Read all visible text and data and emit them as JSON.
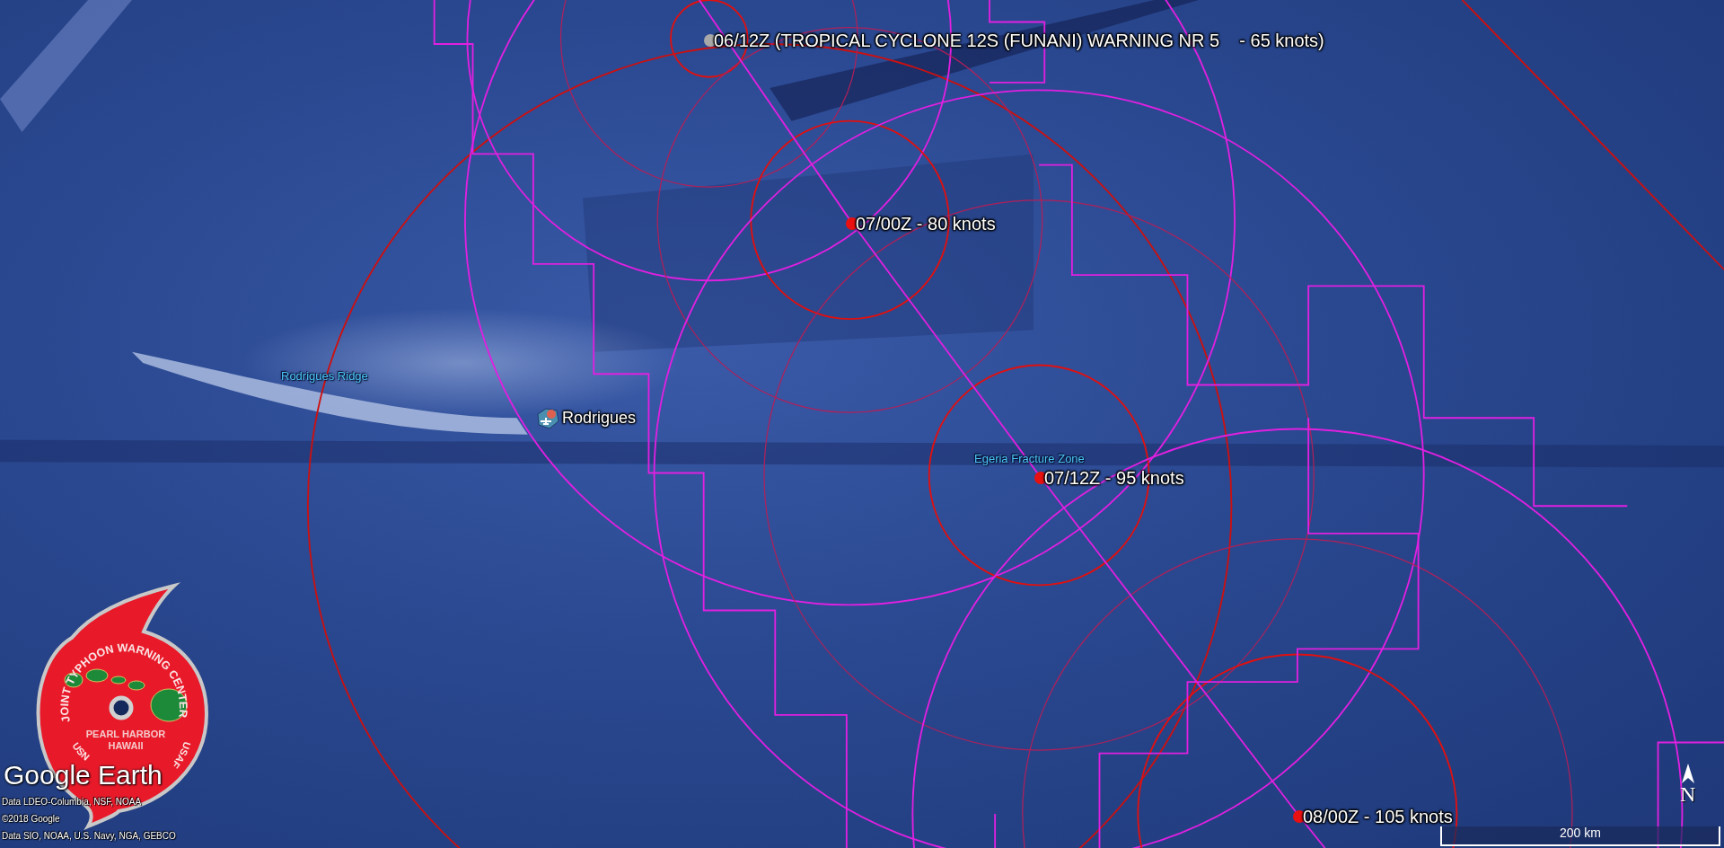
{
  "forecast_points": [
    {
      "label": "06/12Z (TROPICAL CYCLONE 12S (FUNANI) WARNING NR 5    - 65 knots)",
      "current": true
    },
    {
      "label": "07/00Z - 80 knots",
      "current": false
    },
    {
      "label": "07/12Z - 95 knots",
      "current": false
    },
    {
      "label": "08/00Z - 105 knots",
      "current": false
    }
  ],
  "places": [
    {
      "label": "Rodrigues Ridge",
      "kind": "feature"
    },
    {
      "label": "Rodrigues",
      "kind": "island"
    },
    {
      "label": "Egeria Fracture Zone",
      "kind": "feature"
    }
  ],
  "logo": {
    "arc_text": "JOINT TYPHOON WARNING CENTER",
    "center_lines": [
      "PEARL HARBOR",
      "HAWAII"
    ],
    "left_text": "USN",
    "right_text": "USAF"
  },
  "brand": "Google Earth",
  "attribution": [
    "Data LDEO-Columbia, NSF, NOAA",
    "©2018 Google",
    "Data SIO, NOAA, U.S. Navy, NGA, GEBCO"
  ],
  "scale_bar": {
    "label": "200 km"
  },
  "compass": {
    "label": "N"
  }
}
